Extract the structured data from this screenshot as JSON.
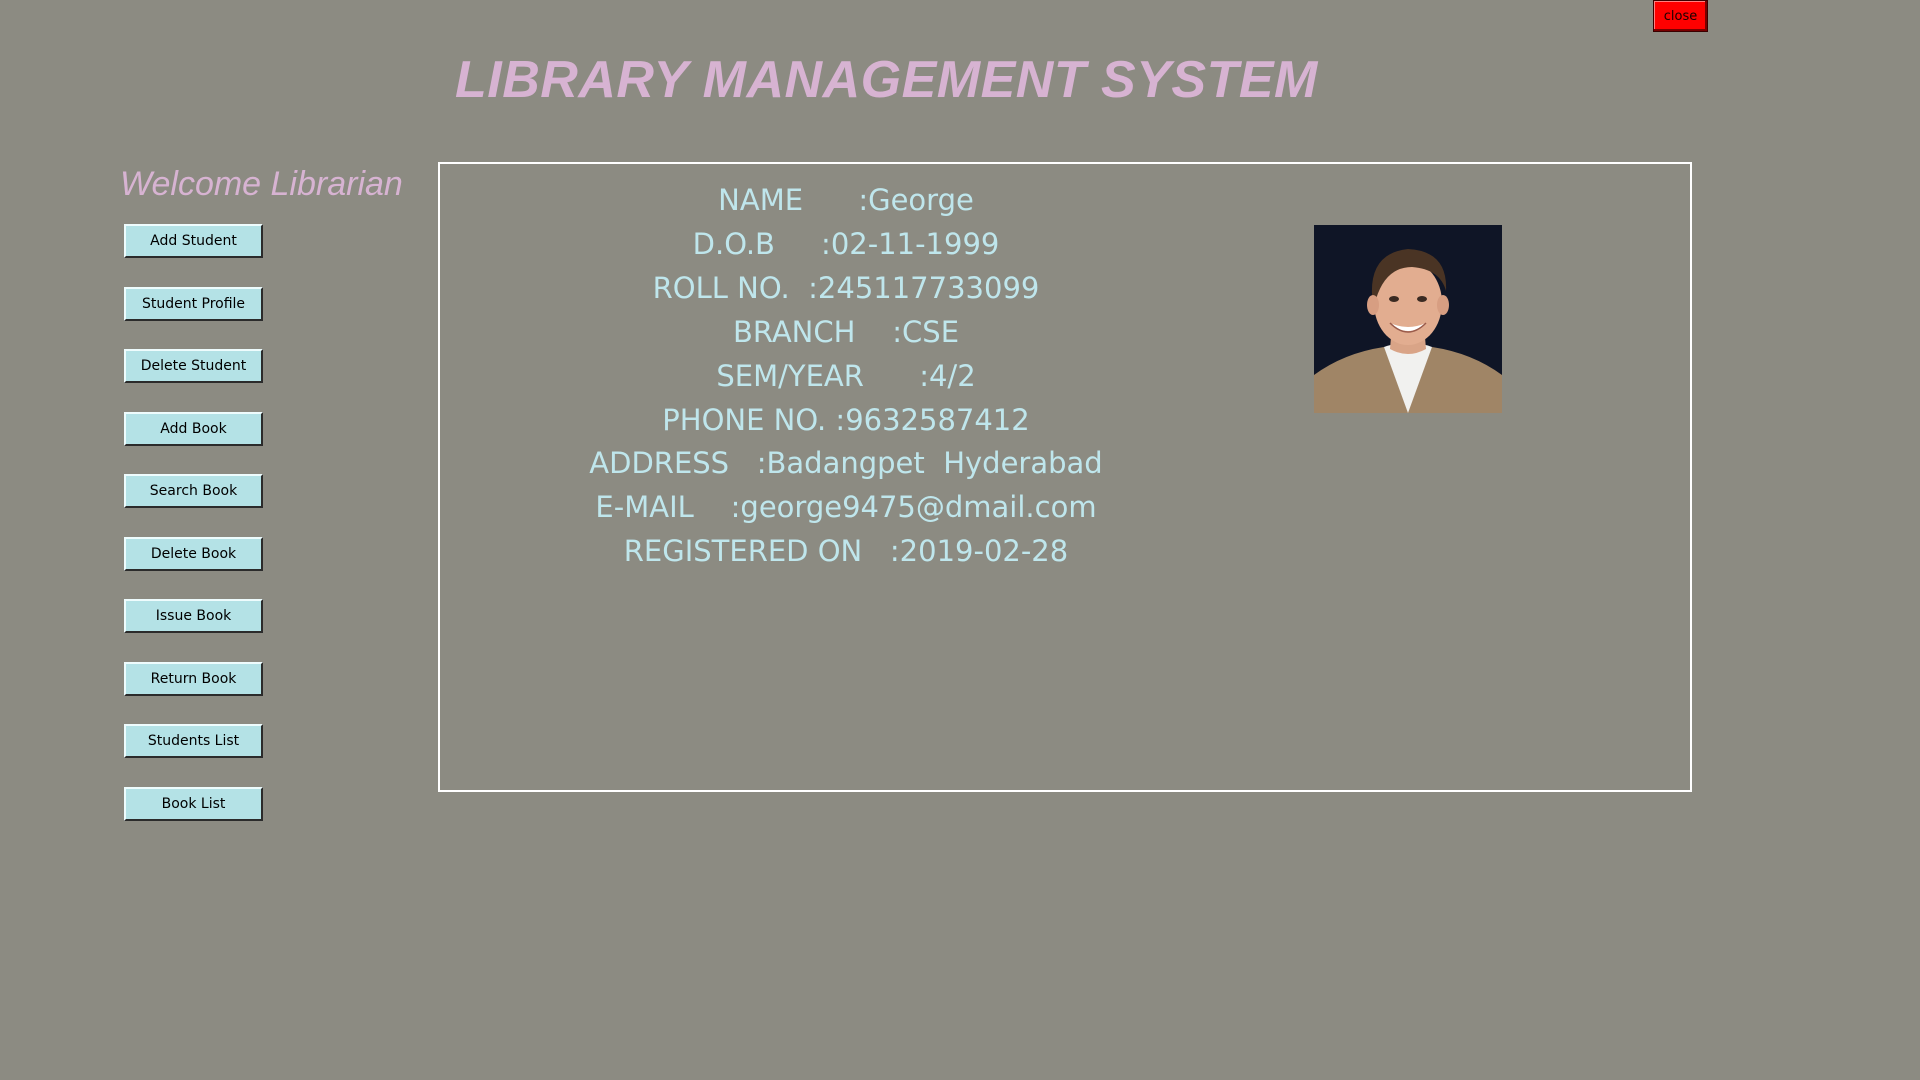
{
  "window": {
    "close_label": "close"
  },
  "header": {
    "title": "LIBRARY MANAGEMENT SYSTEM"
  },
  "sidebar": {
    "welcome": "Welcome Librarian",
    "items": [
      {
        "label": "Add Student"
      },
      {
        "label": "Student Profile"
      },
      {
        "label": "Delete Student"
      },
      {
        "label": "Add Book"
      },
      {
        "label": "Search Book"
      },
      {
        "label": "Delete Book"
      },
      {
        "label": "Issue Book"
      },
      {
        "label": "Return Book"
      },
      {
        "label": "Students List"
      },
      {
        "label": "Book List"
      }
    ]
  },
  "profile": {
    "lines": [
      {
        "text": "NAME      :George"
      },
      {
        "text": "D.O.B     :02-11-1999"
      },
      {
        "text": "ROLL NO.  :245117733099"
      },
      {
        "text": "BRANCH    :CSE"
      },
      {
        "text": "SEM/YEAR      :4/2"
      },
      {
        "text": "PHONE NO. :9632587412"
      },
      {
        "text": "ADDRESS   :Badangpet  Hyderabad"
      },
      {
        "text": "E-MAIL    :george9475@dmail.com"
      },
      {
        "text": "REGISTERED ON   :2019-02-28"
      }
    ],
    "photo_icon": "student-photo"
  },
  "colors": {
    "background": "#8c8b82",
    "title": "#d7b3d2",
    "button": "#b4e2e6",
    "close": "#ff0000",
    "info_text": "#bfe6ec",
    "panel_border": "#ffffff"
  }
}
